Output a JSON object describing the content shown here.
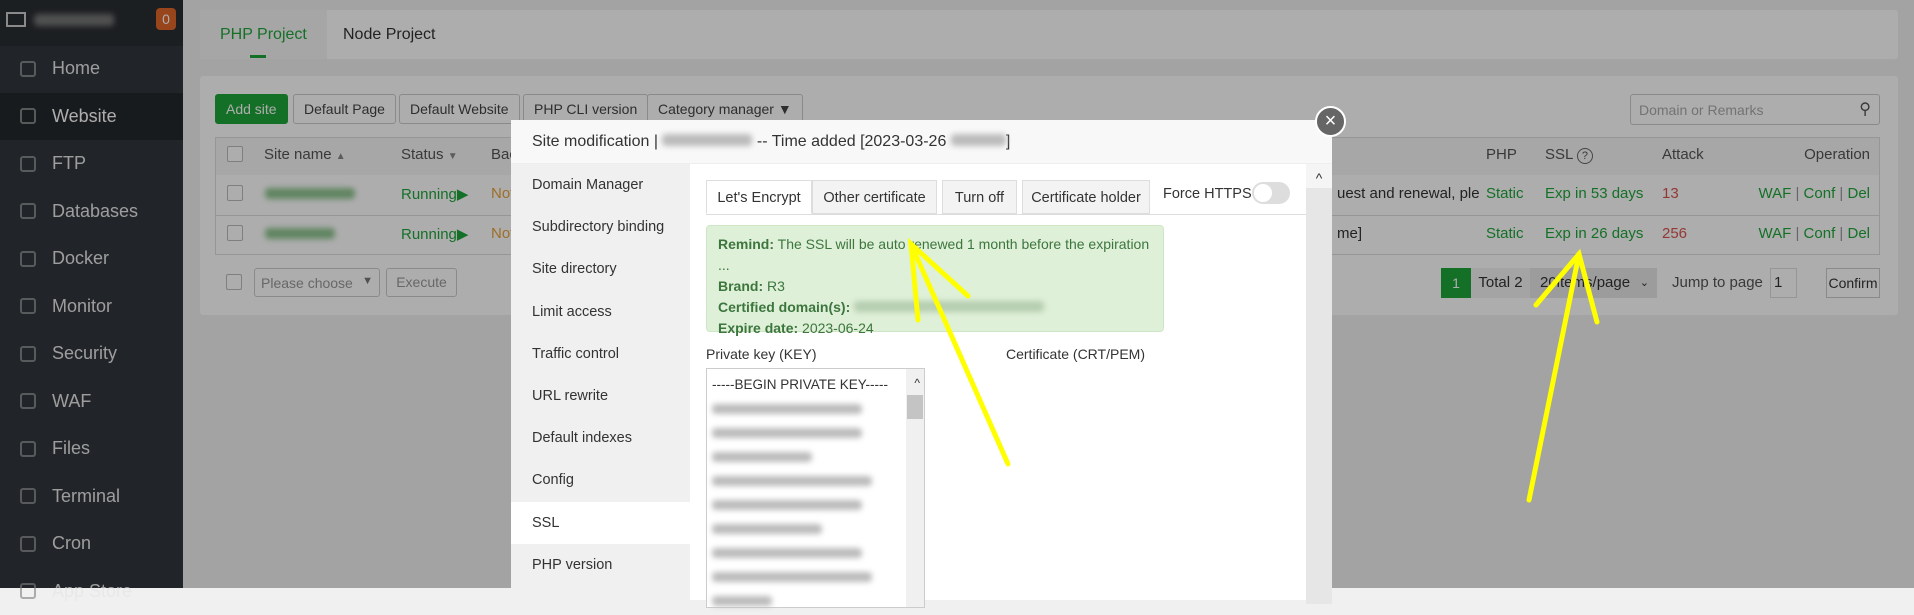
{
  "sidebar": {
    "badge": "0",
    "items": [
      {
        "label": "Home"
      },
      {
        "label": "Website"
      },
      {
        "label": "FTP"
      },
      {
        "label": "Databases"
      },
      {
        "label": "Docker"
      },
      {
        "label": "Monitor"
      },
      {
        "label": "Security"
      },
      {
        "label": "WAF"
      },
      {
        "label": "Files"
      },
      {
        "label": "Terminal"
      },
      {
        "label": "Cron"
      },
      {
        "label": "App Store"
      }
    ]
  },
  "tabs": [
    "PHP Project",
    "Node Project"
  ],
  "toolbar": {
    "add_site": "Add site",
    "default_page": "Default Page",
    "default_website": "Default Website",
    "php_cli": "PHP CLI version",
    "category": "Category manager",
    "search_placeholder": "Domain or Remarks"
  },
  "table": {
    "headers": {
      "site_name": "Site name",
      "status": "Status",
      "backup": "Bac",
      "php": "PHP",
      "ssl": "SSL",
      "attack": "Attack",
      "operation": "Operation"
    },
    "rows": [
      {
        "status": "Running",
        "backup": "Not",
        "remarks": "uest and renewal, ple",
        "php": "Static",
        "ssl": "Exp in 53 days",
        "attack": "13",
        "ops": [
          "WAF",
          "Conf",
          "Del"
        ]
      },
      {
        "status": "Running",
        "backup": "Not",
        "remarks": "me]",
        "php": "Static",
        "ssl": "Exp in 26 days",
        "attack": "256",
        "ops": [
          "WAF",
          "Conf",
          "Del"
        ]
      }
    ]
  },
  "batch": {
    "select_placeholder": "Please choose",
    "execute": "Execute"
  },
  "pagination": {
    "current": "1",
    "total": "Total 2",
    "per_page": "20items/page",
    "jump_label": "Jump to page",
    "jump_value": "1",
    "confirm": "Confirm"
  },
  "modal": {
    "title_prefix": "Site modification |",
    "title_mid": "-- Time added [2023-03-26",
    "title_end": "]",
    "nav": [
      "Domain Manager",
      "Subdirectory binding",
      "Site directory",
      "Limit access",
      "Traffic control",
      "URL rewrite",
      "Default indexes",
      "Config",
      "SSL",
      "PHP version"
    ],
    "ssl_tabs": [
      "Let's Encrypt",
      "Other certificate",
      "Turn off",
      "Certificate holder"
    ],
    "force_https": "Force HTTPS",
    "alert": {
      "remind_label": "Remind:",
      "remind": "The SSL will be auto renewed 1 month before the expiration ...",
      "brand_label": "Brand:",
      "brand": "R3",
      "domains_label": "Certified domain(s):",
      "expire_label": "Expire date:",
      "expire": "2023-06-24"
    },
    "key_label": "Private key (KEY)",
    "key_first_line": "-----BEGIN PRIVATE KEY-----",
    "cert_label": "Certificate (CRT/PEM)"
  },
  "annotation_color": "#ffff00"
}
